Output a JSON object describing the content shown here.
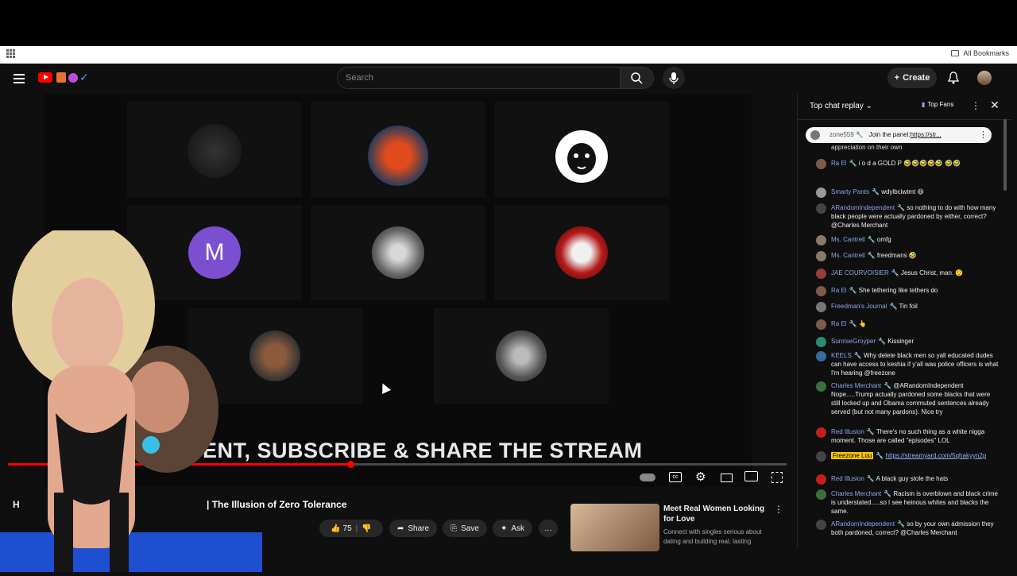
{
  "bookmarks": {
    "all_label": "All Bookmarks"
  },
  "header": {
    "search_placeholder": "Search",
    "create_label": "Create"
  },
  "player": {
    "participants": [
      {
        "initial": ""
      },
      {
        "initial": ""
      },
      {
        "initial": ""
      },
      {
        "initial": "M"
      },
      {
        "initial": ""
      },
      {
        "initial": ""
      },
      {
        "initial": ""
      },
      {
        "initial": ""
      }
    ],
    "banner_text": "ENT, SUBSCRIBE & SHARE THE STREAM",
    "progress": 0.44
  },
  "video": {
    "title_prefix": "H",
    "title": "| The Illusion of Zero Tolerance",
    "likes": "75",
    "share_label": "Share",
    "save_label": "Save",
    "ask_label": "Ask"
  },
  "ad": {
    "title": "Meet Real Women Looking for Love",
    "subtitle": "Connect with singles serious about dating and building real, lasting"
  },
  "chat": {
    "header_title": "Top chat replay",
    "top_fans_label": "Top Fans",
    "pinned": {
      "author": "zone559",
      "text": "Join the panel:",
      "link": "https://str..."
    },
    "cut_top": "appreciation on their own",
    "messages": [
      {
        "author": "Ra El",
        "text": "i o d a GOLD P 🤣🤣🤣🤣🤣 🤣🤣"
      },
      {
        "author": "Smarty Pants",
        "text": "wdylbciwtmt 😆"
      },
      {
        "author": "ARandomIndependent",
        "text": "so nothing to do with how many black people were actually pardoned by either, correct? @Charles Merchant"
      },
      {
        "author": "Ms. Cantrell",
        "text": "omfg"
      },
      {
        "author": "Ms. Cantrell",
        "text": "freedmans 🤣"
      },
      {
        "author": "JAE COURVOISIER",
        "text": "Jesus Christ, man. 🤨"
      },
      {
        "author": "Ra El",
        "text": "She tethering like tethers do"
      },
      {
        "author": "Freedman's Journal",
        "text": "Tin foil"
      },
      {
        "author": "Ra El",
        "text": "👆"
      },
      {
        "author": "SunriseGroyper",
        "text": "Kissinger"
      },
      {
        "author": "KEELS",
        "text": "Why delete black men so yall educated dudes can have access to keshia if y'all was police officers is what I'm hearing @freezone"
      },
      {
        "author": "Charles Merchant",
        "text": "@ARandomIndependent Nope.....Trump actually pardoned some blacks that were still locked up and Obama commuted sentences already served (but not many pardons). Nice try"
      },
      {
        "author": "Red Illusion",
        "text": "There's no such thing as a white nigga moment. Those are called \"episodes\" LOL"
      },
      {
        "author": "Freezone Lou",
        "text": "https://streamyard.com/5qhakyyn2p"
      },
      {
        "author": "Red Illusion",
        "text": "A black guy stole the hats"
      },
      {
        "author": "Charles Merchant",
        "text": "Racism is overblown and black crime is understated.....so I see heinous whites and blacks the same."
      },
      {
        "author": "ARandomIndependent",
        "text": "so by your own admission they both pardoned, correct? @Charles Merchant"
      }
    ]
  }
}
